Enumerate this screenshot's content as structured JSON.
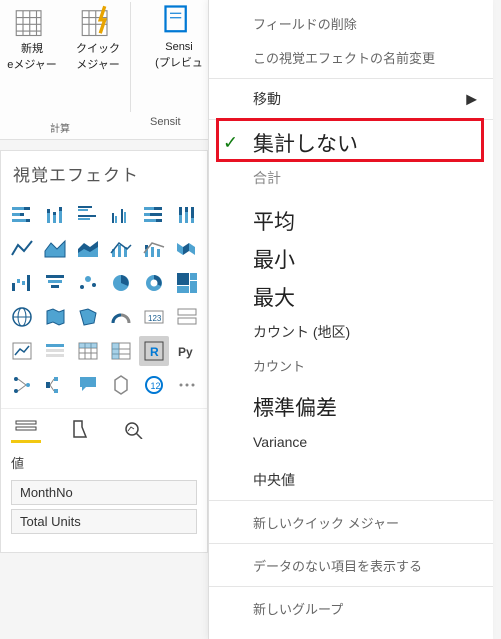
{
  "ribbon": {
    "new": {
      "label1": "新規",
      "label2": "eメジャー"
    },
    "quick": {
      "label1": "クイック",
      "label2": "メジャー"
    },
    "group_label": "計算",
    "sensi": {
      "label": "Sensi",
      "sub": "(プレビュ",
      "foot": "Sensit"
    }
  },
  "viz": {
    "header": "視覚エフェクト",
    "values_label": "値",
    "field1": "MonthNo",
    "field2": "Total Units"
  },
  "menu": {
    "remove_field": "フィールドの削除",
    "rename": "この視覚エフェクトの名前変更",
    "move": "移動",
    "dont_summarize": "集計しない",
    "sum": "合計",
    "average": "平均",
    "min": "最小",
    "max": "最大",
    "count_distinct": "カウント (地区)",
    "count": "カウント",
    "stddev": "標準偏差",
    "variance": "Variance",
    "median": "中央値",
    "new_quick": "新しいクイック メジャー",
    "show_empty": "データのない項目を表示する",
    "new_group": "新しいグループ"
  }
}
